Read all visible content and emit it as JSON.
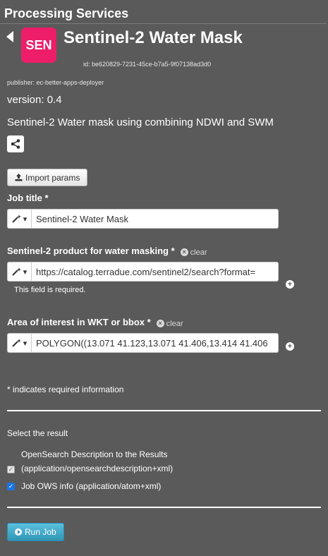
{
  "header": {
    "title": "Processing Services"
  },
  "app": {
    "logo_text": "SEN",
    "logo_color": "#ee1d6a",
    "title": "Sentinel-2 Water Mask",
    "id": "id: be620829-7231-45ce-b7a5-9f07138ad3d0",
    "publisher": "publisher: ec-better-apps-deployer",
    "version": "version: 0.4",
    "description": "Sentinel-2 Water mask using combining NDWI and SWM"
  },
  "import_button": {
    "label": "Import params",
    "icon": "upload-icon"
  },
  "fields": {
    "job_title": {
      "label": "Job title *",
      "value": "Sentinel-2 Water Mask"
    },
    "product": {
      "label": "Sentinel-2 product for water masking *",
      "clear_label": "clear",
      "value": "https://catalog.terradue.com/sentinel2/search?format=",
      "error": "This field is required."
    },
    "aoi": {
      "label": "Area of interest in WKT or bbox *",
      "clear_label": "clear",
      "value": "POLYGON((13.071 41.123,13.071 41.406,13.414 41.406"
    }
  },
  "required_note": "* indicates required information",
  "results": {
    "heading": "Select the result",
    "options": [
      {
        "label_line1": "OpenSearch Description to the Results",
        "label_line2": "(application/opensearchdescription+xml)",
        "checked": true,
        "disabled": true
      },
      {
        "label": "Job OWS info (application/atom+xml)",
        "checked": true,
        "disabled": false
      }
    ]
  },
  "run_button": {
    "label": "Run Job",
    "color": "#2f96b4"
  }
}
